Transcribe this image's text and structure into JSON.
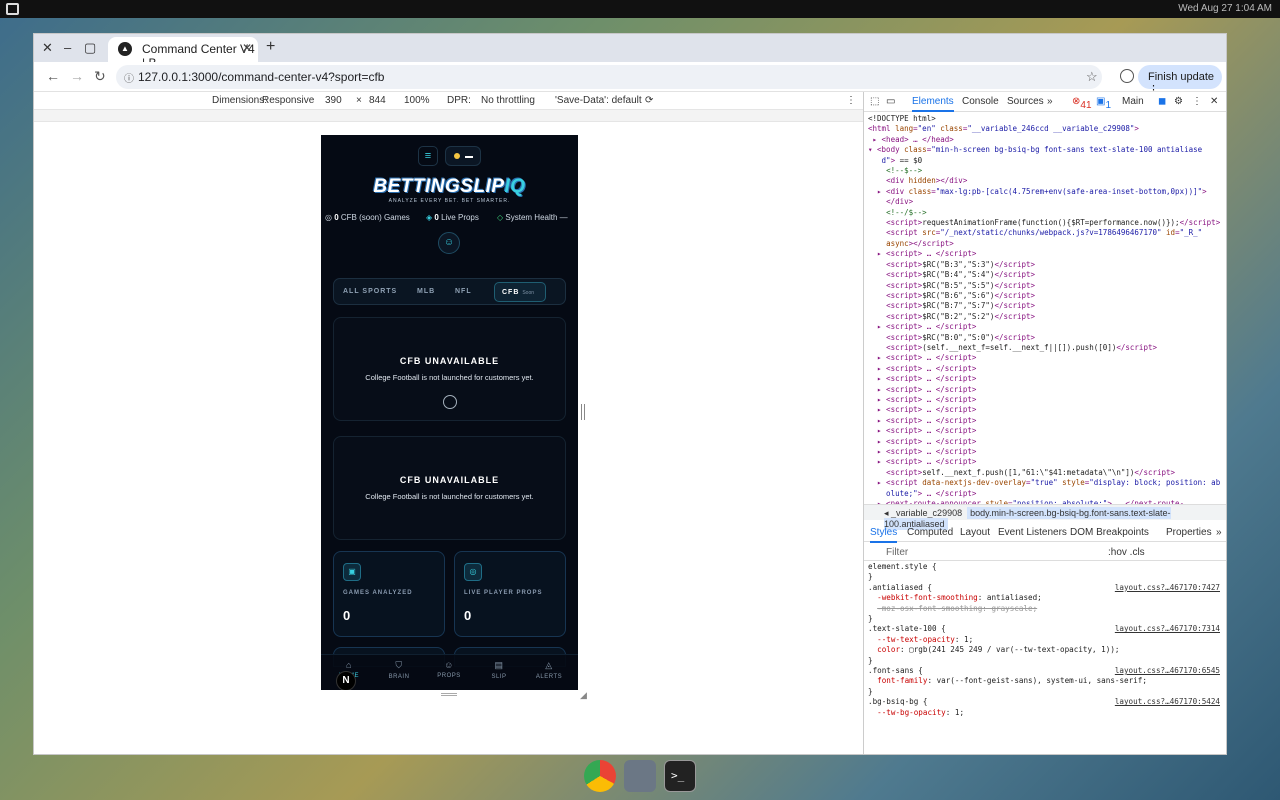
{
  "os": {
    "clock": "Wed Aug 27  1:04 AM"
  },
  "browser": {
    "tab_title": "Command Center V4 | B",
    "url": "127.0.0.1:3000/command-center-v4?sport=cfb",
    "update_button": "Finish update"
  },
  "device_toolbar": {
    "dimensions_label": "Dimensions:",
    "dimensions_value": "Responsive",
    "width": "390",
    "height": "844",
    "zoom": "100%",
    "dpr_label": "DPR:",
    "throttling": "No throttling",
    "save_data": "'Save-Data': default"
  },
  "devtools": {
    "tabs": [
      "Elements",
      "Console",
      "Sources"
    ],
    "errors": "41",
    "messages": "1",
    "context": "Main",
    "breadcrumb_prefix": "_variable_c29908",
    "breadcrumb_selected": "body.min-h-screen.bg-bsiq-bg.font-sans.text-slate-100.antialiased",
    "style_tabs": [
      "Styles",
      "Computed",
      "Layout",
      "Event Listeners",
      "DOM Breakpoints",
      "Properties"
    ],
    "filter_placeholder": "Filter",
    "filter_flags": ":hov .cls"
  },
  "app": {
    "brand_main": "BETTINGSLIP",
    "brand_accent": "IQ",
    "tagline": "ANALYZE EVERY BET. BET SMARTER.",
    "stats": {
      "games_count": "0",
      "games_label": "CFB (soon) Games",
      "props_count": "0",
      "props_label": "Live Props",
      "health_label": "System Health —"
    },
    "sport_tabs": [
      "ALL SPORTS",
      "MLB",
      "NFL"
    ],
    "active_tab": {
      "label": "CFB",
      "badge": "Soon"
    },
    "card1": {
      "title": "CFB UNAVAILABLE",
      "text": "College Football is not launched for customers yet."
    },
    "card2": {
      "title": "CFB UNAVAILABLE",
      "text": "College Football is not launched for customers yet."
    },
    "metrics": [
      {
        "label": "GAMES ANALYZED",
        "value": "0",
        "icon": "grid-icon"
      },
      {
        "label": "LIVE PLAYER PROPS",
        "value": "0",
        "icon": "target-icon"
      }
    ],
    "bottom_nav": [
      "HOME",
      "BRAIN",
      "PROPS",
      "SLIP",
      "ALERTS"
    ],
    "accent_color": "#38d0e0"
  }
}
